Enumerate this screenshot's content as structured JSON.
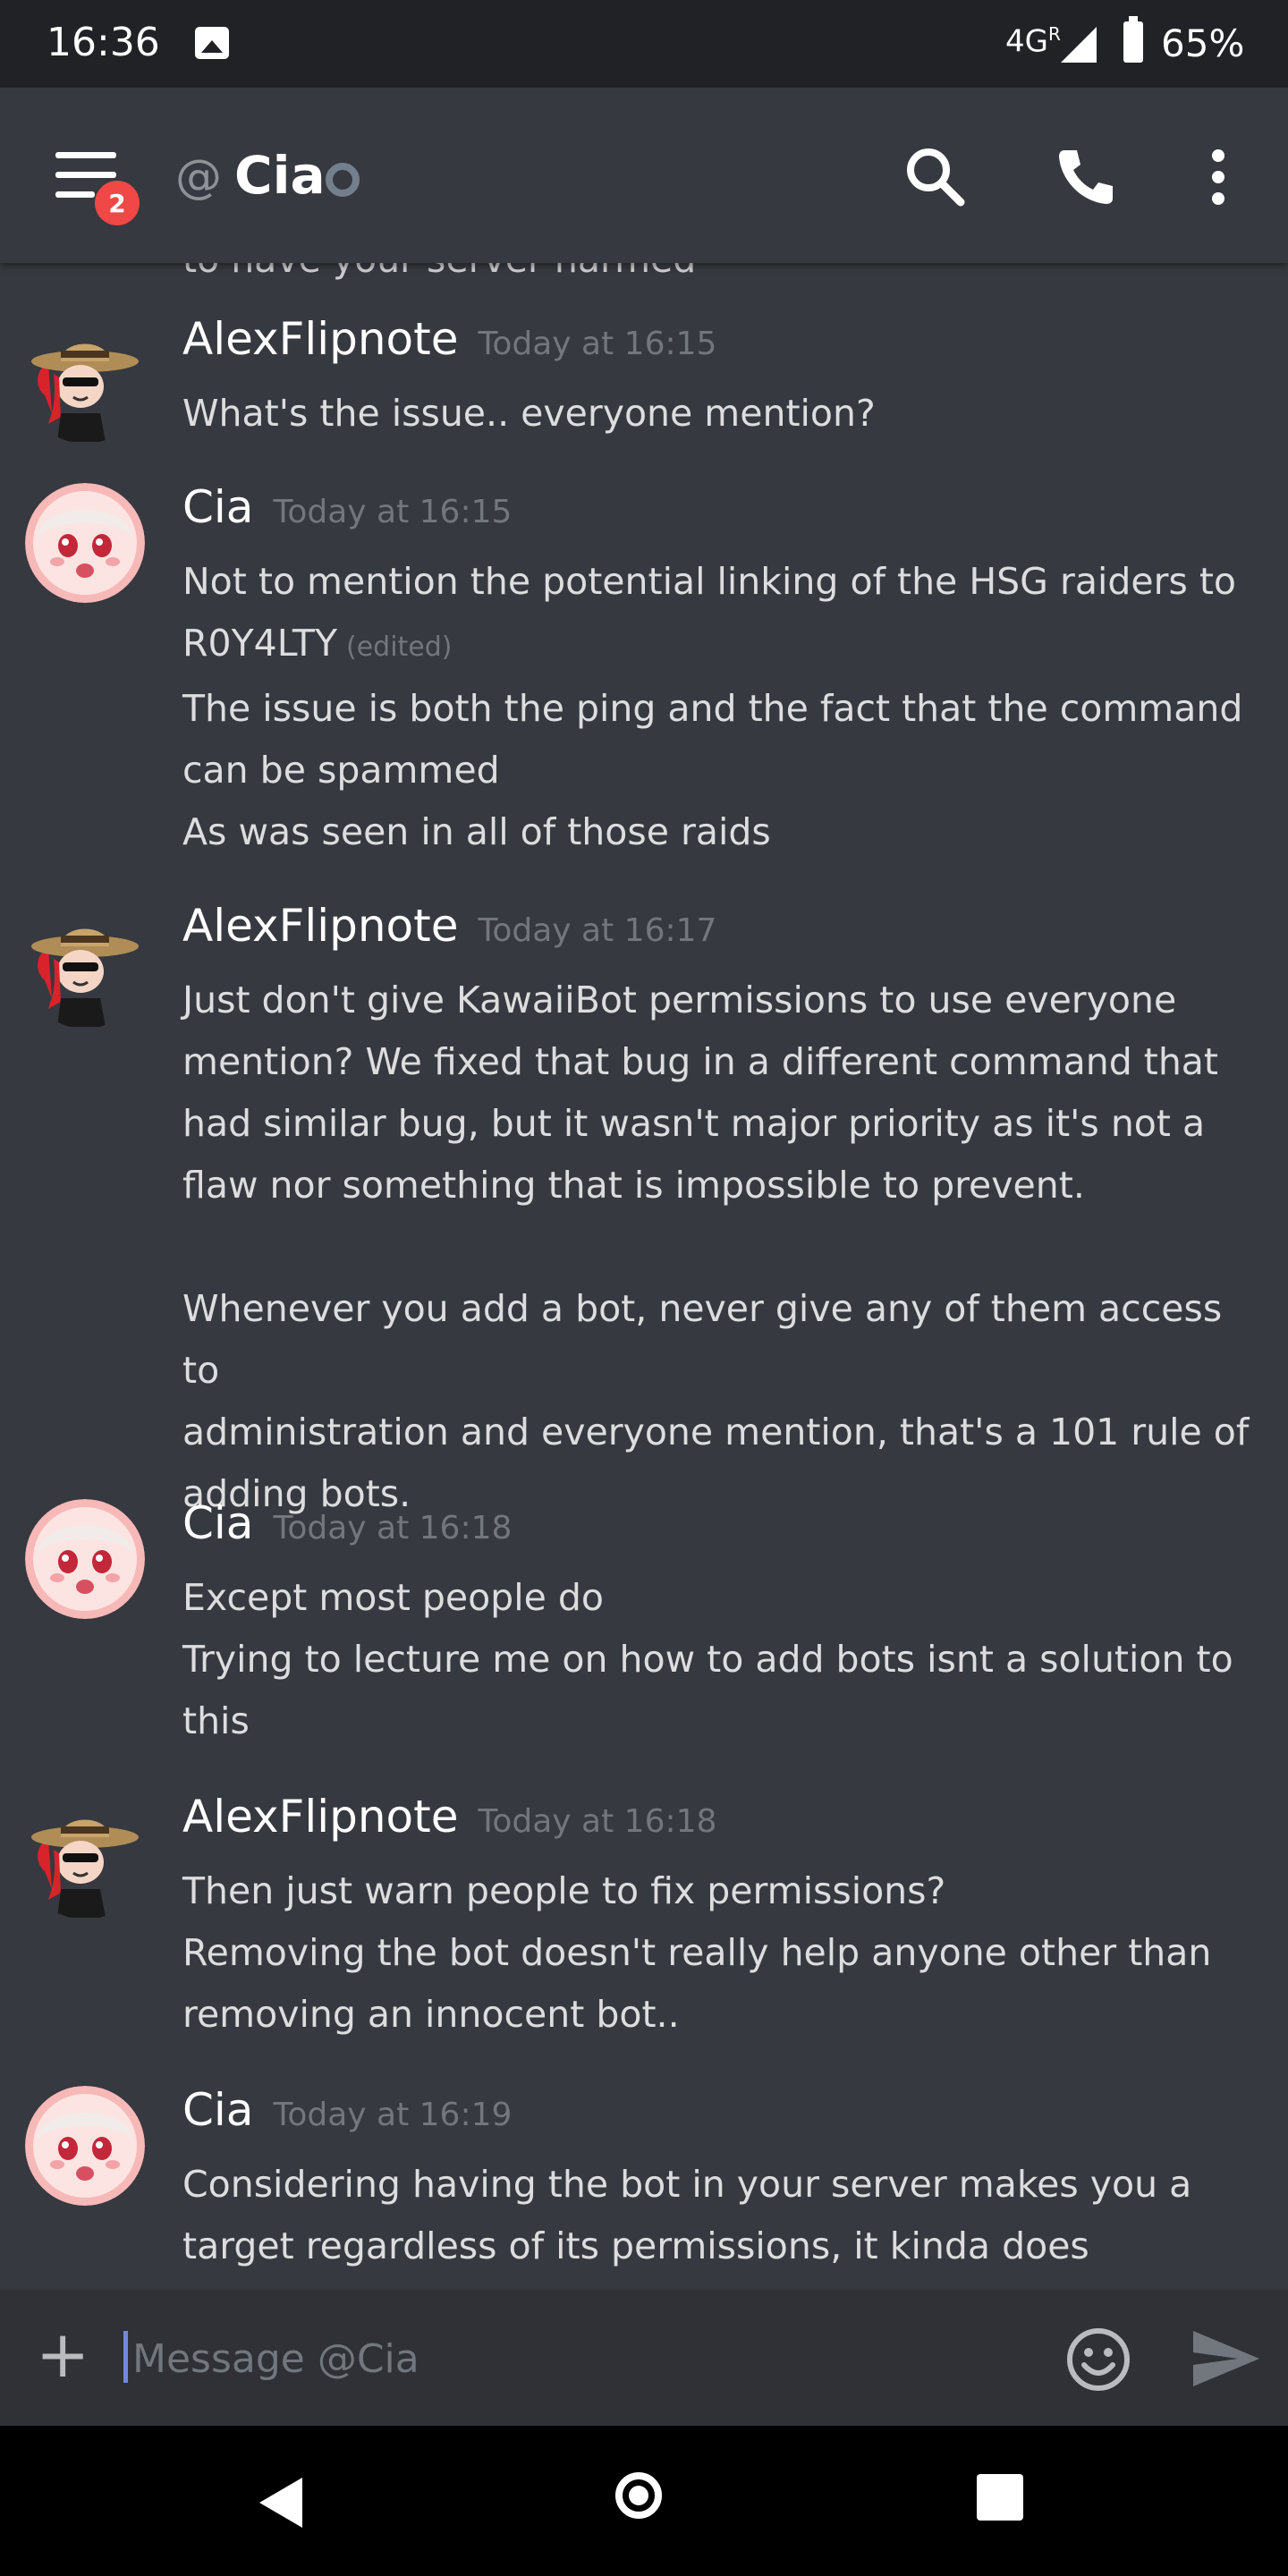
{
  "status_bar": {
    "time": "16:36",
    "network": "4G",
    "network_sup": "R",
    "battery": "65%",
    "icons": [
      "image-icon",
      "signal-icon",
      "battery-icon"
    ]
  },
  "header": {
    "unread_badge": "2",
    "at_symbol": "@",
    "channel_name": "Cia",
    "status": "offline",
    "icons": [
      "menu-icon",
      "search-icon",
      "phone-icon",
      "more-vert-icon"
    ]
  },
  "messages": {
    "cut_off_text": "to have your server harmed",
    "groups": [
      {
        "author": "AlexFlipnote",
        "timestamp": "Today at 16:15",
        "avatar": "alexflipnote-avatar",
        "lines": [
          "What's the issue.. everyone mention?"
        ]
      },
      {
        "author": "Cia",
        "timestamp": "Today at 16:15",
        "avatar": "cia-avatar",
        "lines": [
          "Not to mention the potential linking of the HSG raiders to",
          "R0Y4LTY",
          "The issue is both the ping and the fact that the command",
          "can be spammed",
          "As was seen in all of those raids"
        ],
        "edited_label": "(edited)"
      },
      {
        "author": "AlexFlipnote",
        "timestamp": "Today at 16:17",
        "avatar": "alexflipnote-avatar",
        "lines": [
          "Just don't give KawaiiBot permissions to use everyone",
          "mention? We fixed that bug in a different command that",
          "had similar bug, but it wasn't major priority as it's not a",
          "flaw nor something that is impossible to prevent.",
          "",
          "Whenever you add a bot, never give any of them access to",
          "administration and everyone mention, that's a 101 rule of",
          "adding bots."
        ]
      },
      {
        "author": "Cia",
        "timestamp": "Today at 16:18",
        "avatar": "cia-avatar",
        "lines": [
          "Except most people do",
          "Trying to lecture me on how to add bots isnt a solution to",
          "this"
        ]
      },
      {
        "author": "AlexFlipnote",
        "timestamp": "Today at 16:18",
        "avatar": "alexflipnote-avatar",
        "lines": [
          "Then just warn people to fix permissions?",
          "Removing the bot doesn't really help anyone other than",
          "removing an innocent bot.."
        ]
      },
      {
        "author": "Cia",
        "timestamp": "Today at 16:19",
        "avatar": "cia-avatar",
        "lines": [
          "Considering having the bot in your server makes you a",
          "target regardless of its permissions, it kinda does"
        ]
      }
    ]
  },
  "composer": {
    "placeholder": "Message @Cia",
    "plus_label": "+",
    "icons": [
      "plus-icon",
      "emoji-icon",
      "send-icon"
    ]
  },
  "nav_bar": {
    "icons": [
      "back-icon",
      "home-icon",
      "recents-icon"
    ]
  },
  "colors": {
    "background": "#36393f",
    "status_bar": "#202225",
    "composer": "#2f3136",
    "badge": "#f04747",
    "timestamp": "#72767d",
    "text": "#dcddde",
    "accent": "#7289da"
  }
}
